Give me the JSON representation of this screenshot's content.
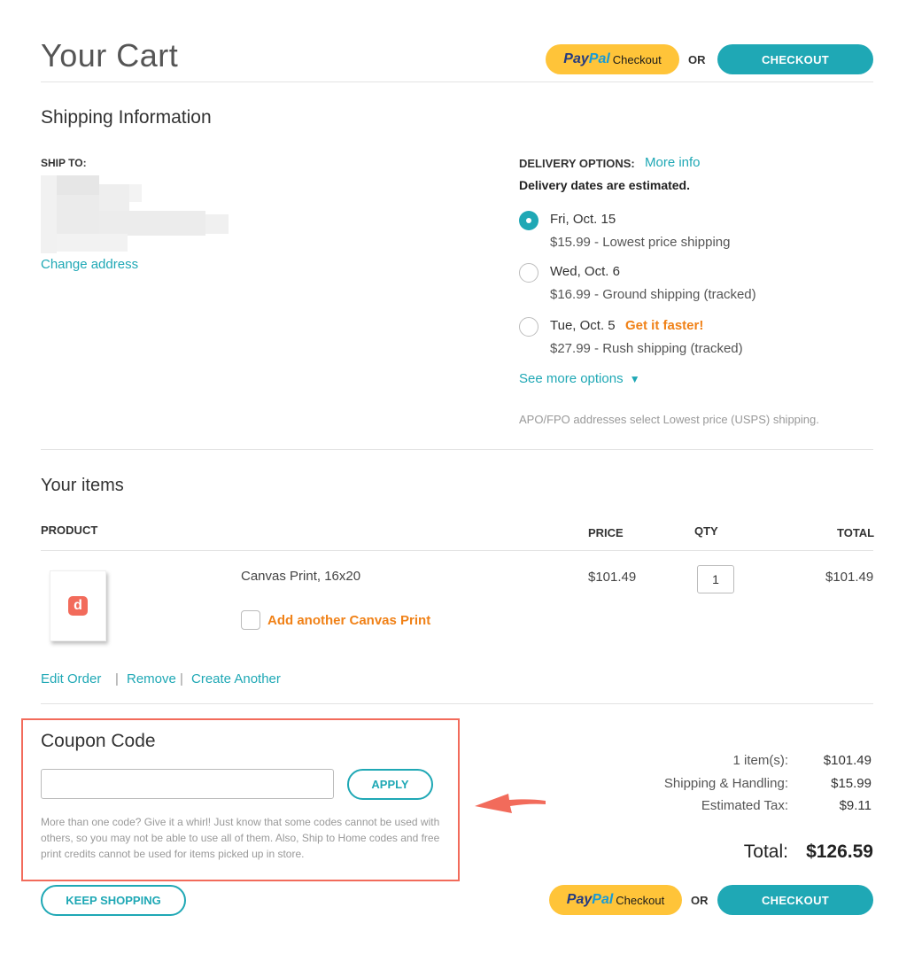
{
  "header": {
    "title": "Your Cart",
    "paypal_word_1": "Pay",
    "paypal_word_2": "Pal",
    "paypal_suffix": "Checkout",
    "or": "OR",
    "checkout_label": "CHECKOUT"
  },
  "shipping": {
    "title": "Shipping Information",
    "ship_to_label": "SHIP TO:",
    "change_address": "Change address",
    "delivery_label": "DELIVERY OPTIONS:",
    "more_info": "More info",
    "estimated_note": "Delivery dates are estimated.",
    "options": [
      {
        "date": "Fri, Oct. 15",
        "desc": "$15.99 - Lowest price shipping",
        "selected": true,
        "badge": ""
      },
      {
        "date": "Wed, Oct. 6",
        "desc": "$16.99 - Ground shipping (tracked)",
        "selected": false,
        "badge": ""
      },
      {
        "date": "Tue, Oct. 5",
        "desc": "$27.99 - Rush shipping (tracked)",
        "selected": false,
        "badge": "Get it faster!"
      }
    ],
    "see_more": "See more options",
    "see_more_icon": "triangle-down-icon",
    "apo_note": "APO/FPO addresses select Lowest price (USPS) shipping."
  },
  "items": {
    "title": "Your items",
    "columns": {
      "product": "PRODUCT",
      "price": "PRICE",
      "qty": "QTY",
      "total": "TOTAL"
    },
    "rows": [
      {
        "name": "Canvas Print, 16x20",
        "price": "$101.49",
        "qty": "1",
        "total": "$101.49",
        "add_another": "Add another Canvas Print",
        "thumb_logo": "d"
      }
    ],
    "actions": {
      "edit": "Edit Order",
      "sep": "|",
      "remove": "Remove",
      "create": "Create Another"
    }
  },
  "coupon": {
    "title": "Coupon Code",
    "input_value": "",
    "apply_label": "APPLY",
    "note": "More than one code? Give it a whirl! Just know that some codes cannot be used with others, so you may not be able to use all of them. Also, Ship to Home codes and free print credits cannot be used for items picked up in store."
  },
  "summary": {
    "items_label": "1 item(s):",
    "items_value": "$101.49",
    "shipping_label": "Shipping & Handling:",
    "shipping_value": "$15.99",
    "tax_label": "Estimated Tax:",
    "tax_value": "$9.11",
    "total_label": "Total:",
    "total_value": "$126.59"
  },
  "footer": {
    "keep_shopping": "KEEP SHOPPING"
  },
  "colors": {
    "accent": "#1fa8b5",
    "orange": "#f08117",
    "highlight": "#f26b5b",
    "paypal_yellow": "#ffc439"
  }
}
